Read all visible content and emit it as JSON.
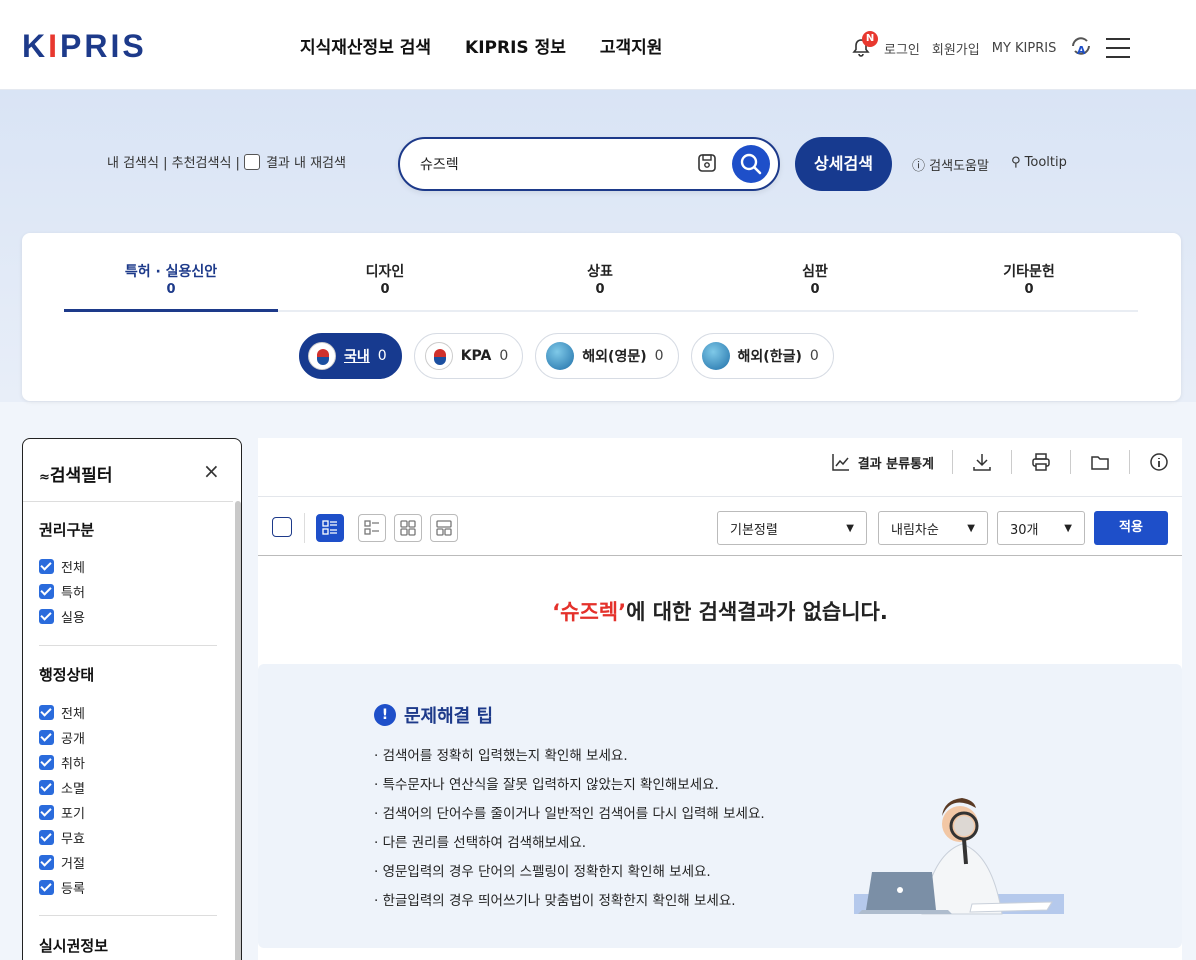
{
  "header": {
    "logo": "KIPRIS",
    "nav": [
      "지식재산정보 검색",
      "KIPRIS 정보",
      "고객지원"
    ],
    "notification_badge": "N",
    "links": [
      "로그인",
      "회원가입",
      "MY KIPRIS"
    ]
  },
  "search": {
    "left_links": "내 검색식 | 추천검색식 |",
    "rescan_label": "결과 내 재검색",
    "query": "슈즈렉",
    "advanced_label": "상세검색",
    "help_label": "검색도움말",
    "tooltip_label": "Tooltip"
  },
  "tabs": [
    {
      "label": "특허 · 실용신안",
      "count": "0"
    },
    {
      "label": "디자인",
      "count": "0"
    },
    {
      "label": "상표",
      "count": "0"
    },
    {
      "label": "심판",
      "count": "0"
    },
    {
      "label": "기타문헌",
      "count": "0"
    }
  ],
  "pills": [
    {
      "label": "국내",
      "count": "0"
    },
    {
      "label": "KPA",
      "count": "0"
    },
    {
      "label": "해외(영문)",
      "count": "0"
    },
    {
      "label": "해외(한글)",
      "count": "0"
    }
  ],
  "filter": {
    "title": "검색필터",
    "close": "×",
    "sections": [
      {
        "title": "권리구분",
        "items": [
          "전체",
          "특허",
          "실용"
        ]
      },
      {
        "title": "행정상태",
        "items": [
          "전체",
          "공개",
          "취하",
          "소멸",
          "포기",
          "무효",
          "거절",
          "등록"
        ]
      },
      {
        "title": "실시권정보",
        "items": []
      }
    ]
  },
  "toolbar": {
    "stats_label": "결과 분류통계",
    "sort": "기본정렬",
    "order": "내림차순",
    "per_page": "30개",
    "apply": "적용"
  },
  "result": {
    "query_quoted": "‘슈즈렉’",
    "message": "에 대한 검색결과가 없습니다."
  },
  "tips": {
    "title": "문제해결 팁",
    "items": [
      "검색어를 정확히 입력했는지 확인해 보세요.",
      "특수문자나 연산식을 잘못 입력하지 않았는지 확인해보세요.",
      "검색어의 단어수를 줄이거나 일반적인 검색어를 다시 입력해 보세요.",
      "다른 권리를 선택하여 검색해보세요.",
      "영문입력의 경우 단어의 스펠링이 정확한지 확인해 보세요.",
      "한글입력의 경우 띄어쓰기나 맞춤법이 정확한지 확인해 보세요."
    ]
  },
  "colors": {
    "primary": "#173a8f",
    "accent": "#1e4fc9",
    "alert": "#e4312b"
  }
}
